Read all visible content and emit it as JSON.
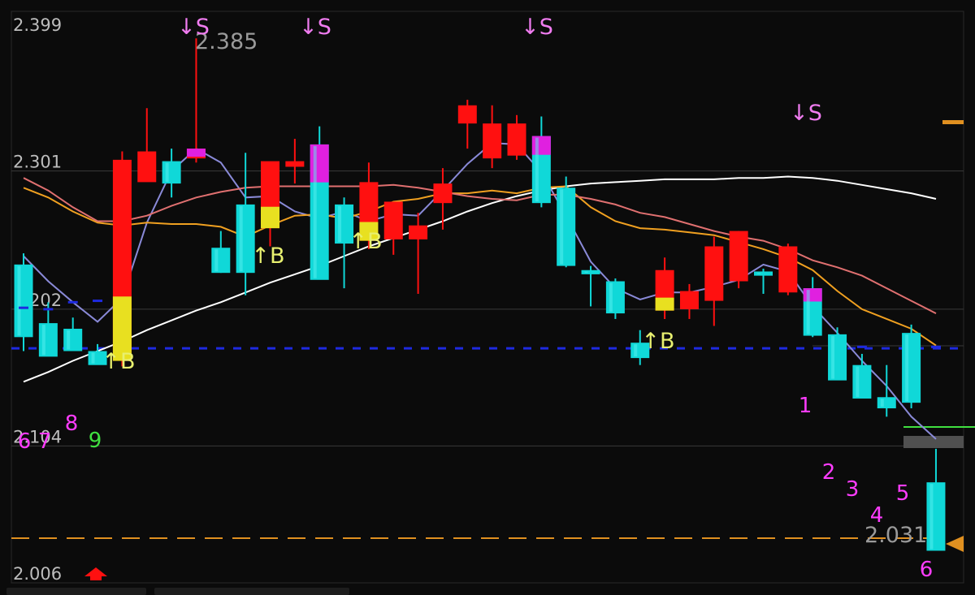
{
  "colors": {
    "background": "#0b0b0b",
    "grid": "#3a3a3a",
    "up_candle": "#ff1010",
    "down_candle": "#10d8d8",
    "magenta_candle": "#e020e0",
    "yellow_candle": "#e8e020",
    "signal_sell": "#f07cf0",
    "signal_buy": "#e8f070",
    "count_magenta": "#ff3cff",
    "count_green": "#40e040",
    "price_label": "#9a9a9a",
    "support_line": "#1e2ae0",
    "bottom_line": "#e09020",
    "ma_white": "#ffffff",
    "ma_purple": "#8a8ad8",
    "ma_orange": "#f0a020",
    "ma_pink": "#e07070",
    "ma_green": "#40b040"
  },
  "chart_data": {
    "type": "candlestick",
    "title": "",
    "xlabel": "",
    "ylabel": "",
    "ylim": [
      2.006,
      2.399
    ],
    "grid": true,
    "y_ticks": [
      "2.399",
      "2.301",
      "2.202",
      "2.104",
      "2.006"
    ],
    "annotations": {
      "high_price": "2.385",
      "low_price": "2.031"
    },
    "candles": [
      {
        "o": 2.227,
        "h": 2.235,
        "l": 2.165,
        "c": 2.175,
        "ov": null
      },
      {
        "o": 2.185,
        "h": 2.2,
        "l": 2.168,
        "c": 2.161,
        "ov": null
      },
      {
        "o": 2.181,
        "h": 2.189,
        "l": 2.175,
        "c": 2.165,
        "ov": null
      },
      {
        "o": 2.165,
        "h": 2.17,
        "l": 2.156,
        "c": 2.155,
        "ov": null
      },
      {
        "o": 2.158,
        "h": 2.308,
        "l": 2.154,
        "c": 2.302,
        "ov": "yellow_bottom"
      },
      {
        "o": 2.286,
        "h": 2.339,
        "l": 2.289,
        "c": 2.308,
        "ov": null
      },
      {
        "o": 2.301,
        "h": 2.31,
        "l": 2.275,
        "c": 2.285,
        "ov": null
      },
      {
        "o": 2.303,
        "h": 2.389,
        "l": 2.3,
        "c": 2.31,
        "ov": "magenta_top"
      },
      {
        "o": 2.239,
        "h": 2.251,
        "l": 2.221,
        "c": 2.221,
        "ov": null
      },
      {
        "o": 2.27,
        "h": 2.307,
        "l": 2.205,
        "c": 2.221,
        "ov": null
      },
      {
        "o": 2.253,
        "h": 2.258,
        "l": 2.24,
        "c": 2.301,
        "ov": "yellow_bottom"
      },
      {
        "o": 2.297,
        "h": 2.317,
        "l": 2.285,
        "c": 2.301,
        "ov": null
      },
      {
        "o": 2.313,
        "h": 2.326,
        "l": 2.218,
        "c": 2.216,
        "ov": "magenta_top"
      },
      {
        "o": 2.27,
        "h": 2.275,
        "l": 2.21,
        "c": 2.242,
        "ov": null
      },
      {
        "o": 2.244,
        "h": 2.3,
        "l": 2.238,
        "c": 2.286,
        "ov": "yellow_bottom"
      },
      {
        "o": 2.245,
        "h": 2.272,
        "l": 2.234,
        "c": 2.272,
        "ov": null
      },
      {
        "o": 2.245,
        "h": 2.264,
        "l": 2.206,
        "c": 2.255,
        "ov": null
      },
      {
        "o": 2.271,
        "h": 2.296,
        "l": 2.252,
        "c": 2.285,
        "ov": null
      },
      {
        "o": 2.328,
        "h": 2.345,
        "l": 2.31,
        "c": 2.341,
        "ov": null
      },
      {
        "o": 2.303,
        "h": 2.341,
        "l": 2.296,
        "c": 2.328,
        "ov": null
      },
      {
        "o": 2.305,
        "h": 2.334,
        "l": 2.302,
        "c": 2.328,
        "ov": null
      },
      {
        "o": 2.319,
        "h": 2.333,
        "l": 2.268,
        "c": 2.271,
        "ov": "magenta_top"
      },
      {
        "o": 2.282,
        "h": 2.29,
        "l": 2.225,
        "c": 2.226,
        "ov": null
      },
      {
        "o": 2.223,
        "h": 2.226,
        "l": 2.197,
        "c": 2.22,
        "ov": null
      },
      {
        "o": 2.215,
        "h": 2.217,
        "l": 2.188,
        "c": 2.192,
        "ov": null
      },
      {
        "o": 2.171,
        "h": 2.18,
        "l": 2.155,
        "c": 2.16,
        "ov": null
      },
      {
        "o": 2.194,
        "h": 2.232,
        "l": 2.188,
        "c": 2.223,
        "ov": "yellow_bottom"
      },
      {
        "o": 2.195,
        "h": 2.213,
        "l": 2.188,
        "c": 2.208,
        "ov": null
      },
      {
        "o": 2.201,
        "h": 2.247,
        "l": 2.183,
        "c": 2.24,
        "ov": null
      },
      {
        "o": 2.215,
        "h": 2.251,
        "l": 2.21,
        "c": 2.251,
        "ov": null
      },
      {
        "o": 2.222,
        "h": 2.224,
        "l": 2.206,
        "c": 2.219,
        "ov": null
      },
      {
        "o": 2.207,
        "h": 2.242,
        "l": 2.205,
        "c": 2.24,
        "ov": null
      },
      {
        "o": 2.21,
        "h": 2.218,
        "l": 2.175,
        "c": 2.176,
        "ov": "magenta_top"
      },
      {
        "o": 2.177,
        "h": 2.182,
        "l": 2.148,
        "c": 2.144,
        "ov": null
      },
      {
        "o": 2.155,
        "h": 2.163,
        "l": 2.133,
        "c": 2.131,
        "ov": null
      },
      {
        "o": 2.132,
        "h": 2.155,
        "l": 2.118,
        "c": 2.124,
        "ov": null
      },
      {
        "o": 2.178,
        "h": 2.184,
        "l": 2.124,
        "c": 2.128,
        "ov": null
      },
      {
        "o": 2.071,
        "h": 2.095,
        "l": 2.029,
        "c": 2.022,
        "ov": null
      }
    ],
    "series": [
      {
        "color": "#ffffff",
        "y": [
          2.143,
          2.15,
          2.158,
          2.165,
          2.172,
          2.18,
          2.187,
          2.194,
          2.2,
          2.207,
          2.214,
          2.22,
          2.226,
          2.233,
          2.24,
          2.246,
          2.252,
          2.258,
          2.265,
          2.271,
          2.276,
          2.28,
          2.283,
          2.285,
          2.286,
          2.287,
          2.288,
          2.288,
          2.288,
          2.289,
          2.289,
          2.29,
          2.289,
          2.287,
          2.284,
          2.281,
          2.278,
          2.274
        ]
      },
      {
        "color": "#8a8ad8",
        "y": [
          2.233,
          2.215,
          2.2,
          2.186,
          2.203,
          2.257,
          2.294,
          2.31,
          2.3,
          2.275,
          2.276,
          2.265,
          2.26,
          2.265,
          2.258,
          2.263,
          2.262,
          2.28,
          2.299,
          2.314,
          2.313,
          2.293,
          2.262,
          2.229,
          2.21,
          2.202,
          2.207,
          2.207,
          2.211,
          2.216,
          2.227,
          2.222,
          2.197,
          2.178,
          2.158,
          2.14,
          2.118,
          2.102
        ]
      },
      {
        "color": "#f0a020",
        "y": [
          2.282,
          2.275,
          2.265,
          2.257,
          2.255,
          2.257,
          2.256,
          2.256,
          2.254,
          2.247,
          2.255,
          2.262,
          2.263,
          2.26,
          2.265,
          2.272,
          2.274,
          2.278,
          2.278,
          2.28,
          2.278,
          2.282,
          2.283,
          2.268,
          2.258,
          2.253,
          2.252,
          2.25,
          2.248,
          2.243,
          2.238,
          2.232,
          2.223,
          2.208,
          2.195,
          2.188,
          2.181,
          2.169
        ]
      },
      {
        "color": "#e07070",
        "y": [
          2.289,
          2.28,
          2.268,
          2.258,
          2.258,
          2.262,
          2.269,
          2.275,
          2.279,
          2.282,
          2.283,
          2.283,
          2.283,
          2.283,
          2.283,
          2.284,
          2.282,
          2.279,
          2.276,
          2.274,
          2.273,
          2.277,
          2.277,
          2.274,
          2.27,
          2.264,
          2.261,
          2.256,
          2.251,
          2.247,
          2.244,
          2.238,
          2.23,
          2.225,
          2.219,
          2.21,
          2.201,
          2.192
        ]
      }
    ],
    "signals": [
      {
        "type": "sell",
        "label": "↓S",
        "i": 7
      },
      {
        "type": "sell",
        "label": "↓S",
        "i": 12
      },
      {
        "type": "sell",
        "label": "↓S",
        "i": 21
      },
      {
        "type": "sell",
        "label": "↓S",
        "i": 33
      },
      {
        "type": "buy",
        "label": "↑B",
        "i": 4
      },
      {
        "type": "buy",
        "label": "↑B",
        "i": 10
      },
      {
        "type": "buy",
        "label": "↑B",
        "i": 14
      },
      {
        "type": "buy",
        "label": "↑B",
        "i": 26
      }
    ],
    "counts": [
      {
        "label": "6",
        "color": "magenta"
      },
      {
        "label": "7",
        "color": "magenta"
      },
      {
        "label": "8",
        "color": "magenta"
      },
      {
        "label": "9",
        "color": "green"
      },
      {
        "label": "1",
        "color": "magenta"
      },
      {
        "label": "2",
        "color": "magenta"
      },
      {
        "label": "3",
        "color": "magenta"
      },
      {
        "label": "4",
        "color": "magenta"
      },
      {
        "label": "5",
        "color": "magenta"
      },
      {
        "label": "6",
        "color": "magenta"
      }
    ],
    "support_level": 2.167,
    "bottom_level": 2.031
  }
}
